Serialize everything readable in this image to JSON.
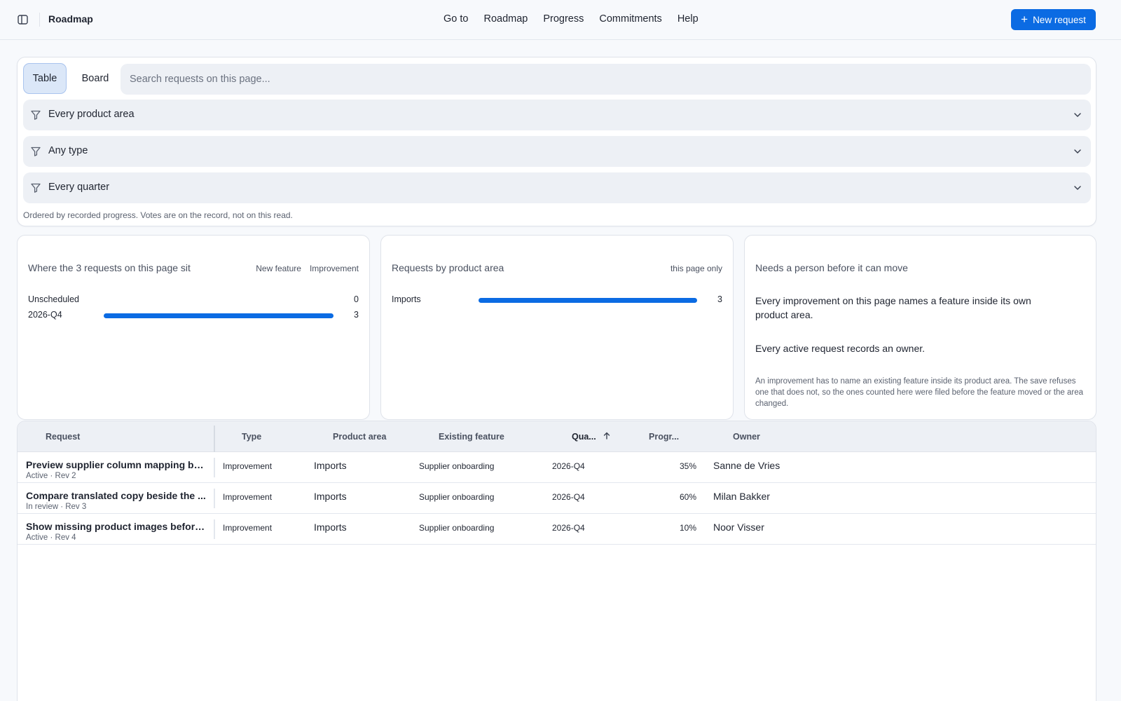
{
  "header": {
    "title": "Roadmap",
    "nav": [
      "Go to",
      "Roadmap",
      "Progress",
      "Commitments",
      "Help"
    ],
    "new_request_label": "New request"
  },
  "toolbar": {
    "views": [
      "Table",
      "Board"
    ],
    "active_view": "Table",
    "search_placeholder": "Search requests on this page...",
    "filters": [
      "Every product area",
      "Any type",
      "Every quarter"
    ],
    "note": "Ordered by recorded progress. Votes are on the record, not on this read."
  },
  "cards": {
    "quarters": {
      "title": "Where the 3 requests on this page sit",
      "legend": [
        "New feature",
        "Improvement"
      ],
      "rows": [
        {
          "label": "Unscheduled",
          "value": "0",
          "fraction": 0
        },
        {
          "label": "2026-Q4",
          "value": "3",
          "fraction": 1
        }
      ]
    },
    "areas": {
      "title": "Requests by product area",
      "legend": "this page only",
      "rows": [
        {
          "label": "Imports",
          "value": "3",
          "fraction": 1
        }
      ]
    },
    "needs": {
      "title": "Needs a person before it can move",
      "lines": [
        "Every improvement on this page names a feature inside its own product area.",
        "Every active request records an owner."
      ],
      "note": "An improvement has to name an existing feature inside its product area. The save refuses one that does not, so the ones counted here were filed before the feature moved or the area changed."
    }
  },
  "table": {
    "columns": {
      "request": "Request",
      "type": "Type",
      "area": "Product area",
      "feature": "Existing feature",
      "quarter": "Qua...",
      "progress": "Progr...",
      "owner": "Owner"
    },
    "sorted_by": "quarter",
    "rows": [
      {
        "title": "Preview supplier column mapping be...",
        "sub": "Active · Rev 2",
        "type": "Improvement",
        "area": "Imports",
        "feature": "Supplier onboarding",
        "quarter": "2026-Q4",
        "progress": "35%",
        "owner": "Sanne de Vries"
      },
      {
        "title": "Compare translated copy beside the ...",
        "sub": "In review · Rev 3",
        "type": "Improvement",
        "area": "Imports",
        "feature": "Supplier onboarding",
        "quarter": "2026-Q4",
        "progress": "60%",
        "owner": "Milan Bakker"
      },
      {
        "title": "Show missing product images before...",
        "sub": "Active · Rev 4",
        "type": "Improvement",
        "area": "Imports",
        "feature": "Supplier onboarding",
        "quarter": "2026-Q4",
        "progress": "10%",
        "owner": "Noor Visser"
      }
    ]
  },
  "colors": {
    "accent": "#0b6be3",
    "filter_bg": "#edf0f5",
    "active_view_bg": "#dbe7f8"
  },
  "icons": [
    "sidebar-toggle-icon",
    "plus-icon",
    "filter-funnel-icon",
    "chevron-down-icon",
    "sort-up-arrow-icon"
  ]
}
